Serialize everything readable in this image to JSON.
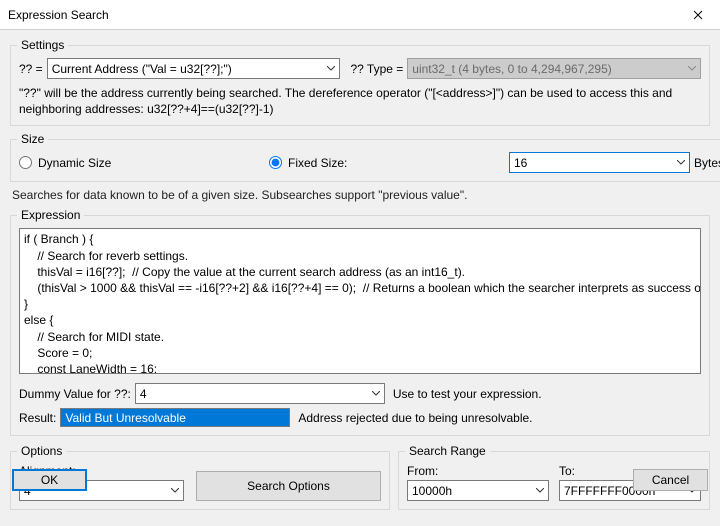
{
  "window": {
    "title": "Expression Search"
  },
  "settings": {
    "legend": "Settings",
    "qq_label": "?? =",
    "qq_value": "Current Address (\"Val = u32[??];\")",
    "type_label": "?? Type =",
    "type_value": "uint32_t (4 bytes, 0 to 4,294,967,295)",
    "help": "\"??\" will be the address currently being searched.  The dereference operator (\"[<address>]\") can be used to access this and neighboring addresses: u32[??+4]==(u32[??]-1)"
  },
  "size": {
    "legend": "Size",
    "dynamic_label": "Dynamic Size",
    "fixed_label": "Fixed Size:",
    "fixed_value": "16",
    "unit": "Bytes",
    "help": "Searches for data known to be of a given size. Subsearches support \"previous value\"."
  },
  "expression": {
    "legend": "Expression",
    "text": "if ( Branch ) {\n    // Search for reverb settings.\n    thisVal = i16[??];  // Copy the value at the current search address (as an int16_t).\n    (thisVal > 1000 && thisVal == -i16[??+2] && i16[??+4] == 0);  // Returns a boolean which the searcher interprets as success or \n}\nelse {\n    // Search for MIDI state.\n    Score = 0;\n    const LaneWidth = 16;",
    "dummy_label": "Dummy Value for ??:",
    "dummy_value": "4",
    "dummy_hint": "Use to test your expression.",
    "result_label": "Result:",
    "result_value": "Valid But Unresolvable",
    "result_hint": "Address rejected due to being unresolvable."
  },
  "options": {
    "legend": "Options",
    "alignment_label": "Alignment:",
    "alignment_value": "4",
    "search_options_label": "Search Options"
  },
  "range": {
    "legend": "Search Range",
    "from_label": "From:",
    "from_value": "10000h",
    "to_label": "To:",
    "to_value": "7FFFFFFF0000h"
  },
  "footer": {
    "ok": "OK",
    "cancel": "Cancel"
  }
}
